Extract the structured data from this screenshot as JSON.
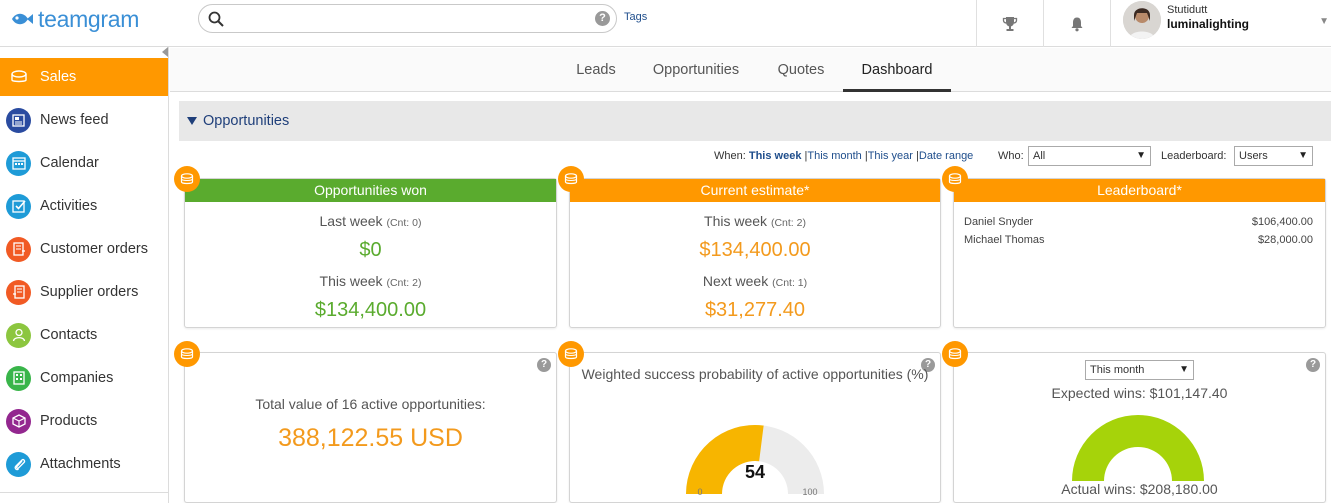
{
  "app": {
    "name": "teamgram"
  },
  "search": {
    "placeholder": "",
    "help": "?",
    "tags_link": "Tags"
  },
  "user": {
    "name": "Stutidutt",
    "company": "luminalighting"
  },
  "sidebar": {
    "items": [
      {
        "label": "Sales",
        "icon": "sales-icon",
        "color": "#ff9800",
        "active": true
      },
      {
        "label": "News feed",
        "icon": "newspaper-icon",
        "color": "#2a4ba0"
      },
      {
        "label": "Calendar",
        "icon": "calendar-icon",
        "color": "#1e9bd7"
      },
      {
        "label": "Activities",
        "icon": "checkbox-icon",
        "color": "#1e9bd7"
      },
      {
        "label": "Customer orders",
        "icon": "order-icon",
        "color": "#f15a24"
      },
      {
        "label": "Supplier orders",
        "icon": "supplier-icon",
        "color": "#f15a24"
      },
      {
        "label": "Contacts",
        "icon": "person-icon",
        "color": "#8cc63f"
      },
      {
        "label": "Companies",
        "icon": "building-icon",
        "color": "#39b54a"
      },
      {
        "label": "Products",
        "icon": "box-icon",
        "color": "#93278f"
      },
      {
        "label": "Attachments",
        "icon": "paperclip-icon",
        "color": "#1e9bd7"
      }
    ]
  },
  "tabs": [
    {
      "label": "Leads"
    },
    {
      "label": "Opportunities"
    },
    {
      "label": "Quotes"
    },
    {
      "label": "Dashboard",
      "active": true
    }
  ],
  "section": {
    "title": "Opportunities"
  },
  "filters": {
    "when_label": "When:",
    "this_week": "This week",
    "this_month": "This month",
    "this_year": "This year",
    "date_range": "Date range",
    "who_label": "Who:",
    "who_value": "All",
    "leaderboard_label": "Leaderboard:",
    "leaderboard_value": "Users"
  },
  "cards": {
    "won": {
      "title": "Opportunities won",
      "color": "#5aab2e",
      "p1_label": "Last week",
      "p1_cnt": "(Cnt: 0)",
      "p1_amount": "$0",
      "p2_label": "This week",
      "p2_cnt": "(Cnt: 2)",
      "p2_amount": "$134,400.00"
    },
    "estimate": {
      "title": "Current estimate*",
      "color": "#ff9800",
      "p1_label": "This week",
      "p1_cnt": "(Cnt: 2)",
      "p1_amount": "$134,400.00",
      "p2_label": "Next week",
      "p2_cnt": "(Cnt: 1)",
      "p2_amount": "$31,277.40"
    },
    "leaderboard": {
      "title": "Leaderboard*",
      "color": "#ff9800",
      "rows": [
        {
          "name": "Daniel Snyder",
          "value": "$106,400.00"
        },
        {
          "name": "Michael Thomas",
          "value": "$28,000.00"
        }
      ]
    },
    "total": {
      "label": "Total value of 16 active opportunities:",
      "value": "388,122.55 USD"
    },
    "probability": {
      "label": "Weighted success probability of active opportunities (%)",
      "value": 54,
      "value_text": "54",
      "min": "0",
      "max": "100",
      "fill_color": "#f7b500"
    },
    "wins": {
      "period": "This month",
      "expected": "Expected wins: $101,147.40",
      "actual": "Actual wins: $208,180.00",
      "fill_color": "#a6d30a"
    }
  },
  "help": "?"
}
